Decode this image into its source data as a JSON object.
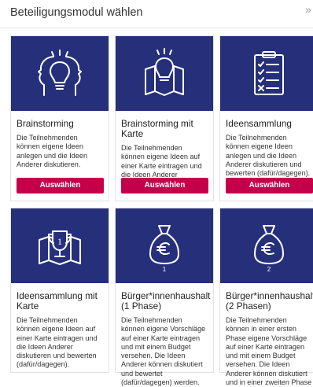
{
  "dialog": {
    "title": "Beteiligungsmodul wählen",
    "close": "»"
  },
  "modules": [
    {
      "name": "Brainstorming",
      "description": "Die Teilnehmenden können eigene Ideen anlegen und die Ideen Anderer diskutieren.",
      "button": "Auswählen",
      "icon": "heads-lightbulb-icon"
    },
    {
      "name": "Brainstorming mit Karte",
      "description": "Die Teilnehmenden können eigene Ideen auf einer Karte eintragen und die Ideen Anderer diskutieren.",
      "button": "Auswählen",
      "icon": "map-lightbulb-icon"
    },
    {
      "name": "Ideensammlung",
      "description": "Die Teilnehmenden können eigene Ideen anlegen und die Ideen Anderer diskutieren und bewerten (dafür/dagegen).",
      "button": "Auswählen",
      "icon": "checklist-clipboard-icon"
    },
    {
      "name": "Ideensammlung mit Karte",
      "description": "Die Teilnehmenden können eigene Ideen auf einer Karte eintragen und die Ideen Anderer diskutieren und bewerten (dafür/dagegen).",
      "icon": "map-trophy-icon"
    },
    {
      "name": "Bürger*innenhaushalt (1 Phase)",
      "description": "Die Teilnehmenden können eigene Vorschläge auf einer Karte eintragen und mit einem Budget versehen. Die Ideen Anderer können diskutiert und bewertet (dafür/dagegen) werden.",
      "icon": "euro-money-bag-icon",
      "phase_number": "1"
    },
    {
      "name": "Bürger*innenhaushalt (2 Phasen)",
      "description": "Die Teilnehmenden können in einer ersten Phase eigene Vorschläge auf einer Karte eintragen und mit einem Budget versehen. Die Ideen Anderer können diskutiert und in einer zweiten Phase",
      "icon": "euro-money-bag-icon",
      "phase_number": "2"
    }
  ],
  "colors": {
    "card_image_bg": "#26307a",
    "button_bg": "#c5004a",
    "button_text": "#ffffff"
  }
}
